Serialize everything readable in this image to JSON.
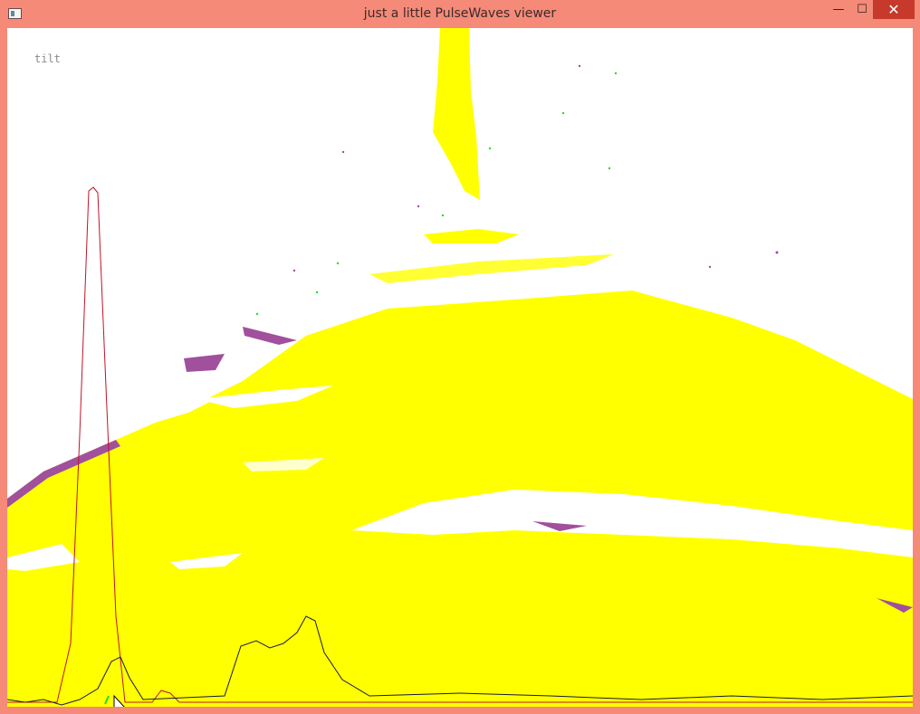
{
  "window": {
    "title": "just a little PulseWaves viewer",
    "controls": {
      "minimize": "—",
      "maximize": "☐",
      "close": "✕"
    }
  },
  "viewer": {
    "mode_label": "tilt",
    "colors": {
      "point_cloud": "#ffff00",
      "secondary_points": "#a0509c",
      "highlight_points": "#22dd22",
      "waveform_red": "#c0142a",
      "waveform_dark": "#1a1a3a",
      "background": "#ffffff"
    }
  }
}
